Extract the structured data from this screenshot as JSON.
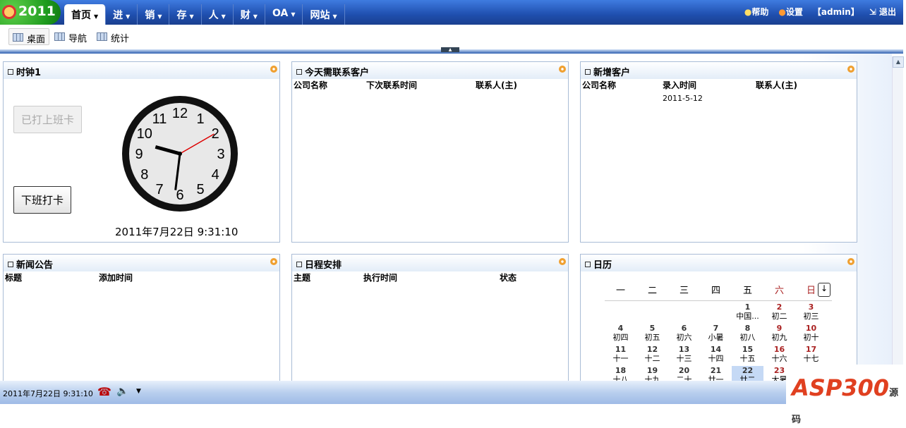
{
  "header": {
    "logo": "2011",
    "nav": [
      {
        "label": "首页",
        "active": true
      },
      {
        "label": "进"
      },
      {
        "label": "销"
      },
      {
        "label": "存"
      },
      {
        "label": "人"
      },
      {
        "label": "财"
      },
      {
        "label": "OA"
      },
      {
        "label": "网站"
      }
    ],
    "help": "帮助",
    "settings": "设置",
    "user": "【admin】",
    "logout": "退出"
  },
  "toolbar": [
    {
      "label": "桌面",
      "active": true
    },
    {
      "label": "导航"
    },
    {
      "label": "统计"
    }
  ],
  "panels": {
    "clock": {
      "title": "时钟1",
      "checked_in": "已打上班卡",
      "check_out": "下班打卡",
      "datetime": "2011年7月22日  9:31:10",
      "hour": 9,
      "minute": 31,
      "second": 10
    },
    "contacts": {
      "title": "今天需联系客户",
      "columns": [
        "公司名称",
        "下次联系时间",
        "联系人(主)"
      ]
    },
    "new_customers": {
      "title": "新增客户",
      "columns": [
        "公司名称",
        "录入时间",
        "联系人(主)"
      ],
      "rows": [
        [
          "",
          "2011-5-12",
          ""
        ]
      ]
    },
    "news": {
      "title": "新闻公告",
      "columns": [
        "标题",
        "添加时间"
      ]
    },
    "schedule": {
      "title": "日程安排",
      "columns": [
        "主题",
        "执行时间",
        "状态"
      ]
    },
    "calendar": {
      "title": "日历",
      "weekdays": [
        "一",
        "二",
        "三",
        "四",
        "五",
        "六",
        "日"
      ],
      "today": 22,
      "days": [
        null,
        null,
        null,
        null,
        {
          "d": "1",
          "l": "中国..."
        },
        {
          "d": "2",
          "l": "初二"
        },
        {
          "d": "3",
          "l": "初三"
        },
        {
          "d": "4",
          "l": "初四"
        },
        {
          "d": "5",
          "l": "初五"
        },
        {
          "d": "6",
          "l": "初六"
        },
        {
          "d": "7",
          "l": "小暑"
        },
        {
          "d": "8",
          "l": "初八"
        },
        {
          "d": "9",
          "l": "初九"
        },
        {
          "d": "10",
          "l": "初十"
        },
        {
          "d": "11",
          "l": "十一"
        },
        {
          "d": "12",
          "l": "十二"
        },
        {
          "d": "13",
          "l": "十三"
        },
        {
          "d": "14",
          "l": "十四"
        },
        {
          "d": "15",
          "l": "十五"
        },
        {
          "d": "16",
          "l": "十六"
        },
        {
          "d": "17",
          "l": "十七"
        },
        {
          "d": "18",
          "l": "十八"
        },
        {
          "d": "19",
          "l": "十九"
        },
        {
          "d": "20",
          "l": "二十"
        },
        {
          "d": "21",
          "l": "廿一"
        },
        {
          "d": "22",
          "l": "廿二"
        },
        {
          "d": "23",
          "l": "大暑"
        }
      ]
    }
  },
  "status": {
    "datetime": "2011年7月22日  9:31:10"
  },
  "watermark": "ASP300源码"
}
